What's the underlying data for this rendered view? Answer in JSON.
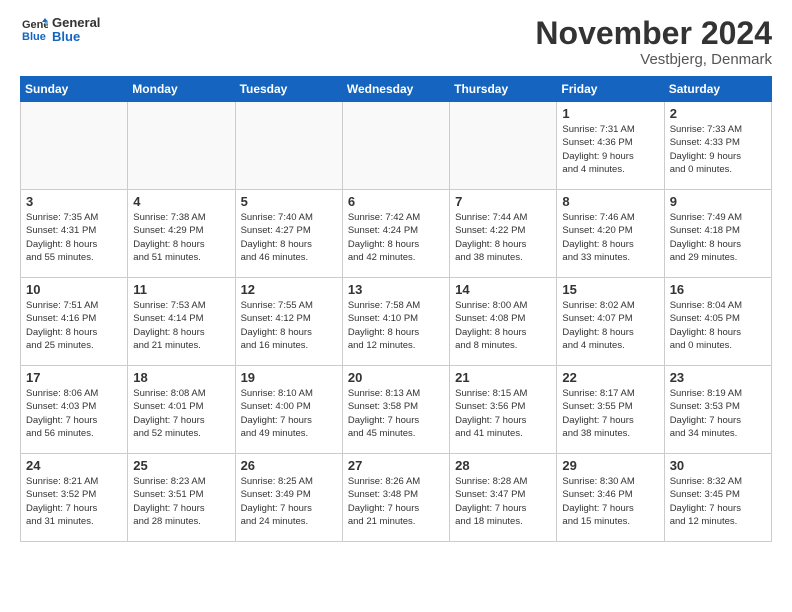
{
  "logo": {
    "line1": "General",
    "line2": "Blue"
  },
  "title": "November 2024",
  "location": "Vestbjerg, Denmark",
  "days_header": [
    "Sunday",
    "Monday",
    "Tuesday",
    "Wednesday",
    "Thursday",
    "Friday",
    "Saturday"
  ],
  "weeks": [
    [
      {
        "day": "",
        "info": ""
      },
      {
        "day": "",
        "info": ""
      },
      {
        "day": "",
        "info": ""
      },
      {
        "day": "",
        "info": ""
      },
      {
        "day": "",
        "info": ""
      },
      {
        "day": "1",
        "info": "Sunrise: 7:31 AM\nSunset: 4:36 PM\nDaylight: 9 hours\nand 4 minutes."
      },
      {
        "day": "2",
        "info": "Sunrise: 7:33 AM\nSunset: 4:33 PM\nDaylight: 9 hours\nand 0 minutes."
      }
    ],
    [
      {
        "day": "3",
        "info": "Sunrise: 7:35 AM\nSunset: 4:31 PM\nDaylight: 8 hours\nand 55 minutes."
      },
      {
        "day": "4",
        "info": "Sunrise: 7:38 AM\nSunset: 4:29 PM\nDaylight: 8 hours\nand 51 minutes."
      },
      {
        "day": "5",
        "info": "Sunrise: 7:40 AM\nSunset: 4:27 PM\nDaylight: 8 hours\nand 46 minutes."
      },
      {
        "day": "6",
        "info": "Sunrise: 7:42 AM\nSunset: 4:24 PM\nDaylight: 8 hours\nand 42 minutes."
      },
      {
        "day": "7",
        "info": "Sunrise: 7:44 AM\nSunset: 4:22 PM\nDaylight: 8 hours\nand 38 minutes."
      },
      {
        "day": "8",
        "info": "Sunrise: 7:46 AM\nSunset: 4:20 PM\nDaylight: 8 hours\nand 33 minutes."
      },
      {
        "day": "9",
        "info": "Sunrise: 7:49 AM\nSunset: 4:18 PM\nDaylight: 8 hours\nand 29 minutes."
      }
    ],
    [
      {
        "day": "10",
        "info": "Sunrise: 7:51 AM\nSunset: 4:16 PM\nDaylight: 8 hours\nand 25 minutes."
      },
      {
        "day": "11",
        "info": "Sunrise: 7:53 AM\nSunset: 4:14 PM\nDaylight: 8 hours\nand 21 minutes."
      },
      {
        "day": "12",
        "info": "Sunrise: 7:55 AM\nSunset: 4:12 PM\nDaylight: 8 hours\nand 16 minutes."
      },
      {
        "day": "13",
        "info": "Sunrise: 7:58 AM\nSunset: 4:10 PM\nDaylight: 8 hours\nand 12 minutes."
      },
      {
        "day": "14",
        "info": "Sunrise: 8:00 AM\nSunset: 4:08 PM\nDaylight: 8 hours\nand 8 minutes."
      },
      {
        "day": "15",
        "info": "Sunrise: 8:02 AM\nSunset: 4:07 PM\nDaylight: 8 hours\nand 4 minutes."
      },
      {
        "day": "16",
        "info": "Sunrise: 8:04 AM\nSunset: 4:05 PM\nDaylight: 8 hours\nand 0 minutes."
      }
    ],
    [
      {
        "day": "17",
        "info": "Sunrise: 8:06 AM\nSunset: 4:03 PM\nDaylight: 7 hours\nand 56 minutes."
      },
      {
        "day": "18",
        "info": "Sunrise: 8:08 AM\nSunset: 4:01 PM\nDaylight: 7 hours\nand 52 minutes."
      },
      {
        "day": "19",
        "info": "Sunrise: 8:10 AM\nSunset: 4:00 PM\nDaylight: 7 hours\nand 49 minutes."
      },
      {
        "day": "20",
        "info": "Sunrise: 8:13 AM\nSunset: 3:58 PM\nDaylight: 7 hours\nand 45 minutes."
      },
      {
        "day": "21",
        "info": "Sunrise: 8:15 AM\nSunset: 3:56 PM\nDaylight: 7 hours\nand 41 minutes."
      },
      {
        "day": "22",
        "info": "Sunrise: 8:17 AM\nSunset: 3:55 PM\nDaylight: 7 hours\nand 38 minutes."
      },
      {
        "day": "23",
        "info": "Sunrise: 8:19 AM\nSunset: 3:53 PM\nDaylight: 7 hours\nand 34 minutes."
      }
    ],
    [
      {
        "day": "24",
        "info": "Sunrise: 8:21 AM\nSunset: 3:52 PM\nDaylight: 7 hours\nand 31 minutes."
      },
      {
        "day": "25",
        "info": "Sunrise: 8:23 AM\nSunset: 3:51 PM\nDaylight: 7 hours\nand 28 minutes."
      },
      {
        "day": "26",
        "info": "Sunrise: 8:25 AM\nSunset: 3:49 PM\nDaylight: 7 hours\nand 24 minutes."
      },
      {
        "day": "27",
        "info": "Sunrise: 8:26 AM\nSunset: 3:48 PM\nDaylight: 7 hours\nand 21 minutes."
      },
      {
        "day": "28",
        "info": "Sunrise: 8:28 AM\nSunset: 3:47 PM\nDaylight: 7 hours\nand 18 minutes."
      },
      {
        "day": "29",
        "info": "Sunrise: 8:30 AM\nSunset: 3:46 PM\nDaylight: 7 hours\nand 15 minutes."
      },
      {
        "day": "30",
        "info": "Sunrise: 8:32 AM\nSunset: 3:45 PM\nDaylight: 7 hours\nand 12 minutes."
      }
    ]
  ]
}
